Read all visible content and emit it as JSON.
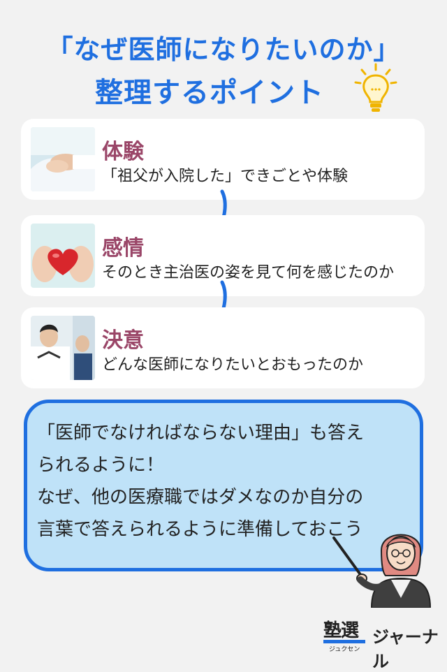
{
  "title": {
    "line1": "「なぜ医師になりたいのか」",
    "line2": "整理するポイント"
  },
  "cards": [
    {
      "title": "体験",
      "body": "「祖父が入院した」できごとや体験"
    },
    {
      "title": "感情",
      "body": "そのとき主治医の姿を見て何を感じたのか"
    },
    {
      "title": "決意",
      "body": "どんな医師になりたいとおもったのか"
    }
  ],
  "bubble": {
    "lines": [
      "「医師でなければならない理由」も答え",
      "られるように！",
      "なぜ、他の医療職ではダメなのか自分の",
      "言葉で答えられるように準備しておこう"
    ]
  },
  "logo": {
    "kanji": "塾選",
    "kana": "ジュクセン",
    "journal": "ジャーナル"
  },
  "icons": [
    "lightbulb-icon",
    "down-arrow-icon",
    "teacher-with-pointer-illustration"
  ],
  "colors": {
    "accent": "#1f6fe0",
    "card_title": "#9a4668",
    "bubble_fill": "#bfe2f8",
    "background": "#f2f2f2"
  }
}
